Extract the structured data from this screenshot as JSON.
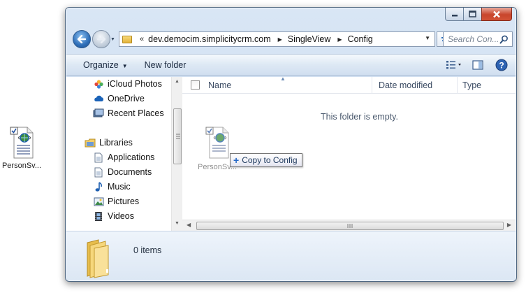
{
  "desktop": {
    "file_label": "PersonSv..."
  },
  "window": {
    "address": {
      "overflow_chevron": "«",
      "crumbs": [
        "dev.democim.simplicitycrm.com",
        "SingleView",
        "Config"
      ]
    },
    "search_placeholder": "Search Con...",
    "toolbar": {
      "organize_label": "Organize",
      "new_folder_label": "New folder"
    },
    "nav_pane": {
      "favorites": [
        "iCloud Photos",
        "OneDrive",
        "Recent Places"
      ],
      "libraries_label": "Libraries",
      "libraries": [
        "Applications",
        "Documents",
        "Music",
        "Pictures",
        "Videos"
      ]
    },
    "columns": {
      "name": "Name",
      "date_modified": "Date modified",
      "type": "Type"
    },
    "empty_message": "This folder is empty.",
    "drag": {
      "ghost_label": "PersonSv...",
      "tooltip_label": "Copy to Config"
    },
    "details": {
      "item_count": "0 items"
    }
  },
  "colors": {
    "accent": "#2e6eb8",
    "frame": "#c5d7ee",
    "close_button": "#c8452c"
  }
}
